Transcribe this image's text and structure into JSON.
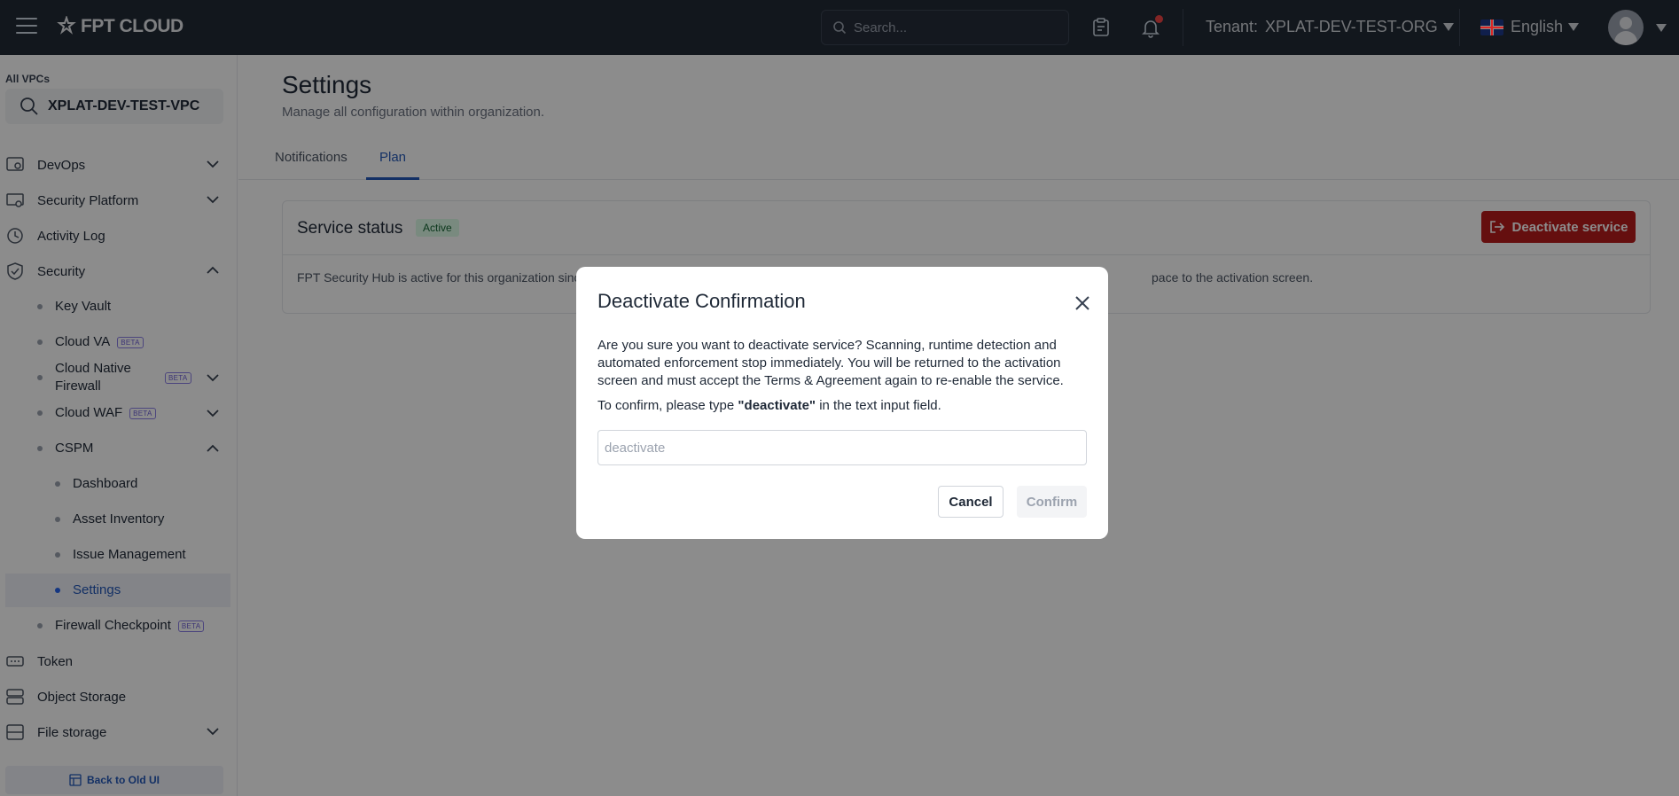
{
  "topbar": {
    "logo_text": "FPT CLOUD",
    "search_placeholder": "Search...",
    "tenant_label": "Tenant:",
    "tenant_value": "XPLAT-DEV-TEST-ORG",
    "language": "English",
    "icons": [
      "menu-icon",
      "clipboard-icon",
      "bell-icon",
      "uk-flag-icon",
      "avatar-icon"
    ]
  },
  "sidebar": {
    "vpc_label": "All VPCs",
    "vpc_value": "XPLAT-DEV-TEST-VPC",
    "items": [
      {
        "label": "DevOps",
        "icon": "devops-icon",
        "expandable": true
      },
      {
        "label": "Security Platform",
        "icon": "security-platform-icon",
        "expandable": true
      },
      {
        "label": "Activity Log",
        "icon": "clock-icon",
        "expandable": false
      },
      {
        "label": "Security",
        "icon": "shield-icon",
        "expanded": true
      }
    ],
    "security_children": [
      {
        "label": "Key Vault"
      },
      {
        "label": "Cloud VA",
        "beta": "BETA"
      },
      {
        "label": "Cloud Native Firewall",
        "beta": "BETA"
      },
      {
        "label": "Cloud WAF",
        "beta": "BETA"
      },
      {
        "label": "CSPM"
      }
    ],
    "cspm_children": [
      {
        "label": "Dashboard"
      },
      {
        "label": "Asset Inventory"
      },
      {
        "label": "Issue Management"
      },
      {
        "label": "Settings",
        "active": true
      }
    ],
    "firewall_checkpoint": {
      "label": "Firewall Checkpoint",
      "beta": "BETA"
    },
    "bottom_items": [
      {
        "label": "Token",
        "icon": "token-icon"
      },
      {
        "label": "Object Storage",
        "icon": "object-storage-icon"
      },
      {
        "label": "File storage",
        "icon": "file-storage-icon"
      }
    ],
    "back_old_ui": "Back to Old UI"
  },
  "main": {
    "title": "Settings",
    "subtitle": "Manage all configuration within organization.",
    "tabs": [
      {
        "label": "Notifications"
      },
      {
        "label": "Plan",
        "active": true
      }
    ],
    "card": {
      "title": "Service status",
      "status_badge": "Active",
      "deactivate_label": "Deactivate service",
      "text_left": "FPT Security Hub is active for this organization sinc",
      "text_right": "pace to the activation screen."
    }
  },
  "modal": {
    "title": "Deactivate Confirmation",
    "body": "Are you sure you want to deactivate service? Scanning, runtime detection and automated enforcement stop immediately. You will be returned to the activation screen and must accept the Terms & Agreement again to re-enable the service.",
    "confirm_prefix": "To confirm, please type ",
    "confirm_keyword": "\"deactivate\"",
    "confirm_suffix": " in the text input field.",
    "input_placeholder": "deactivate",
    "input_value": "",
    "cancel_label": "Cancel",
    "confirm_label": "Confirm"
  },
  "colors": {
    "topbar_bg": "#222a36",
    "accent": "#2458b8",
    "danger": "#b91c1c",
    "active_badge_bg": "#dcfce7"
  }
}
